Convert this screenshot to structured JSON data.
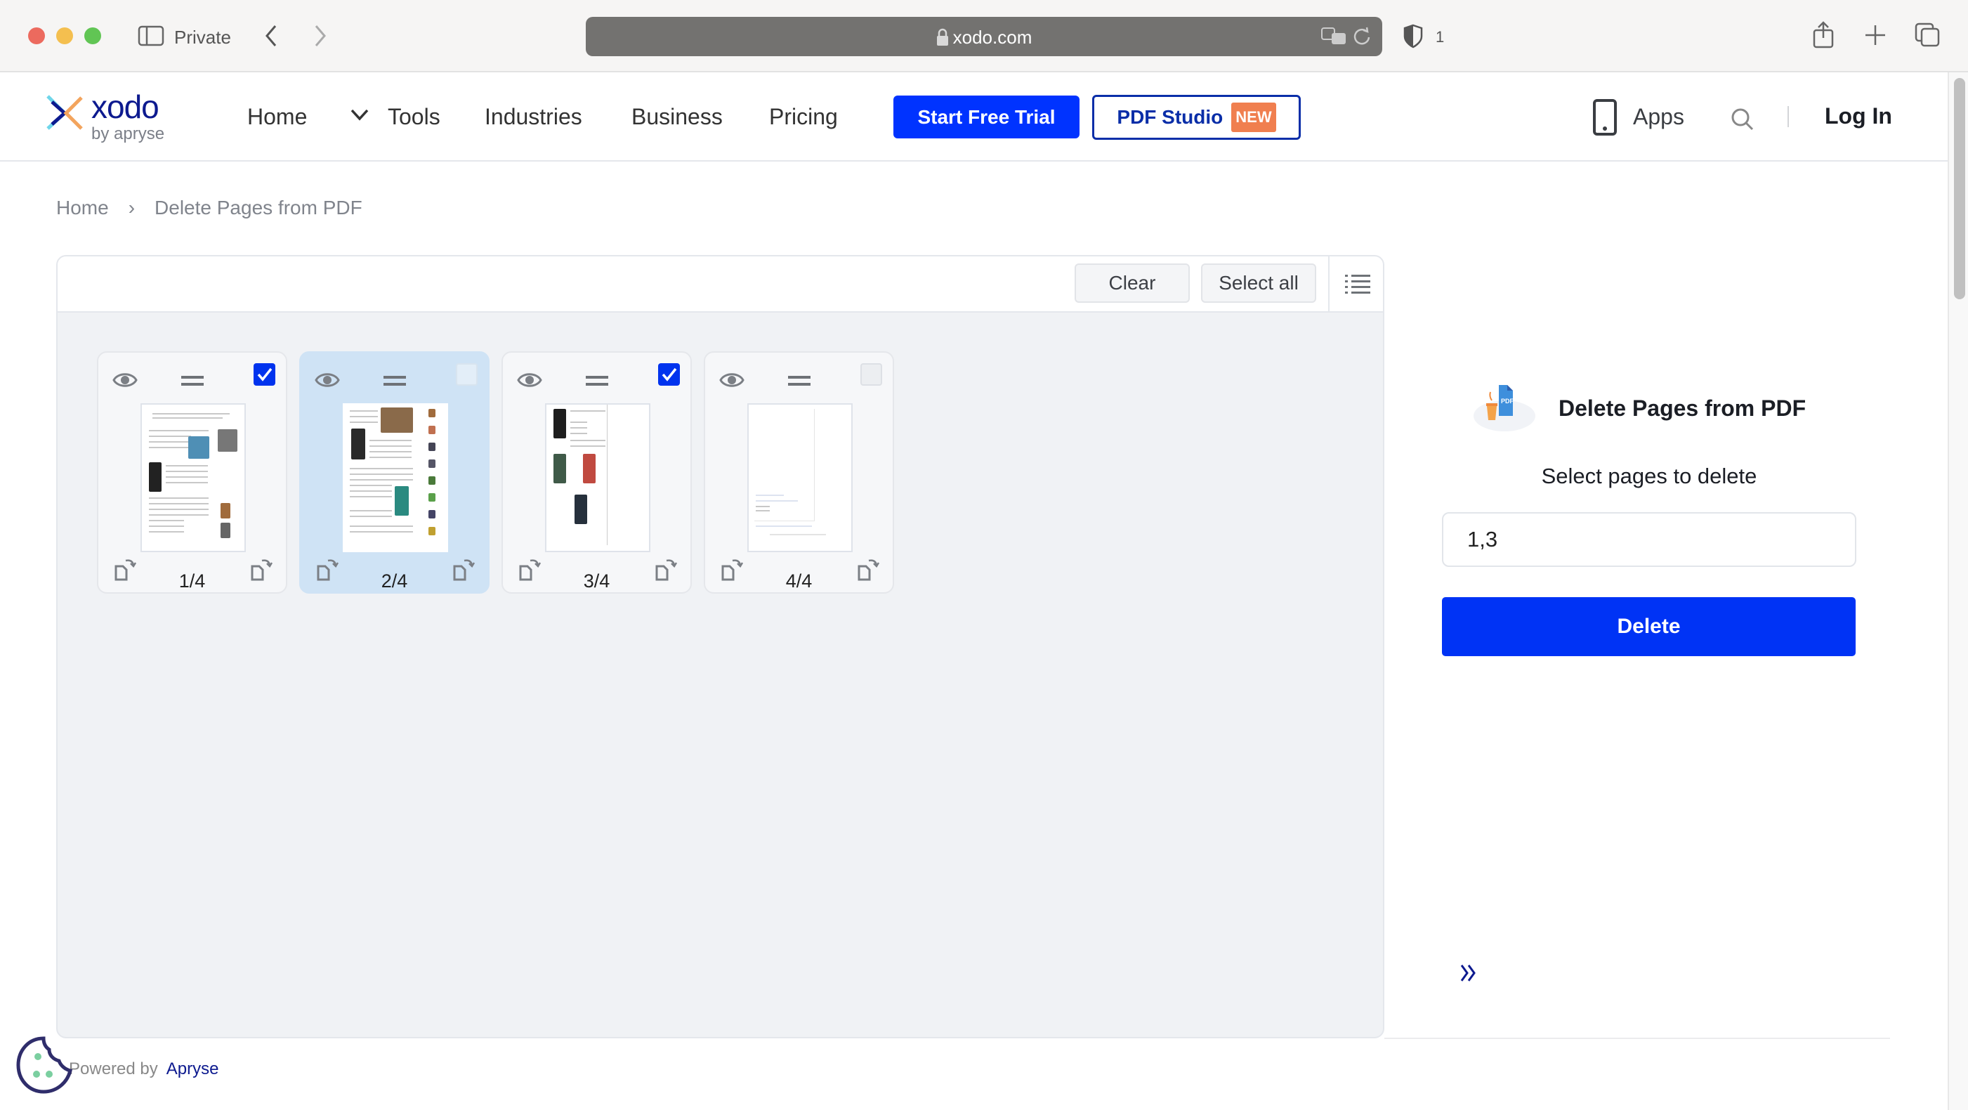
{
  "browser": {
    "mode_label": "Private",
    "url": "xodo.com",
    "shield_count": "1"
  },
  "header": {
    "logo_text": "xodo",
    "logo_sub": "by apryse",
    "nav": [
      {
        "label": "Home"
      },
      {
        "label": "Tools"
      },
      {
        "label": "Industries"
      },
      {
        "label": "Business"
      },
      {
        "label": "Pricing"
      }
    ],
    "trial_button": "Start Free Trial",
    "studio_button": "PDF Studio",
    "studio_badge": "NEW",
    "apps_label": "Apps",
    "login_label": "Log In"
  },
  "breadcrumb": {
    "items": [
      {
        "label": "Home"
      },
      {
        "label": "Delete Pages from PDF"
      }
    ],
    "separator": "›"
  },
  "editor": {
    "clear_label": "Clear",
    "select_all_label": "Select all",
    "pages": [
      {
        "label": "1/4",
        "checked": true,
        "highlighted": false
      },
      {
        "label": "2/4",
        "checked": false,
        "highlighted": true
      },
      {
        "label": "3/4",
        "checked": true,
        "highlighted": false
      },
      {
        "label": "4/4",
        "checked": false,
        "highlighted": false
      }
    ]
  },
  "tool": {
    "title": "Delete Pages from PDF",
    "icon_badge": "PDF",
    "subtitle": "Select pages to delete",
    "pages_value": "1,3",
    "delete_label": "Delete"
  },
  "footer": {
    "powered_prefix": "Powered by",
    "powered_brand": "Apryse"
  },
  "colors": {
    "accent": "#0033f5",
    "brand_navy": "#0d1a8f",
    "badge_orange": "#f07f4f",
    "highlight": "#cfe3f5"
  }
}
